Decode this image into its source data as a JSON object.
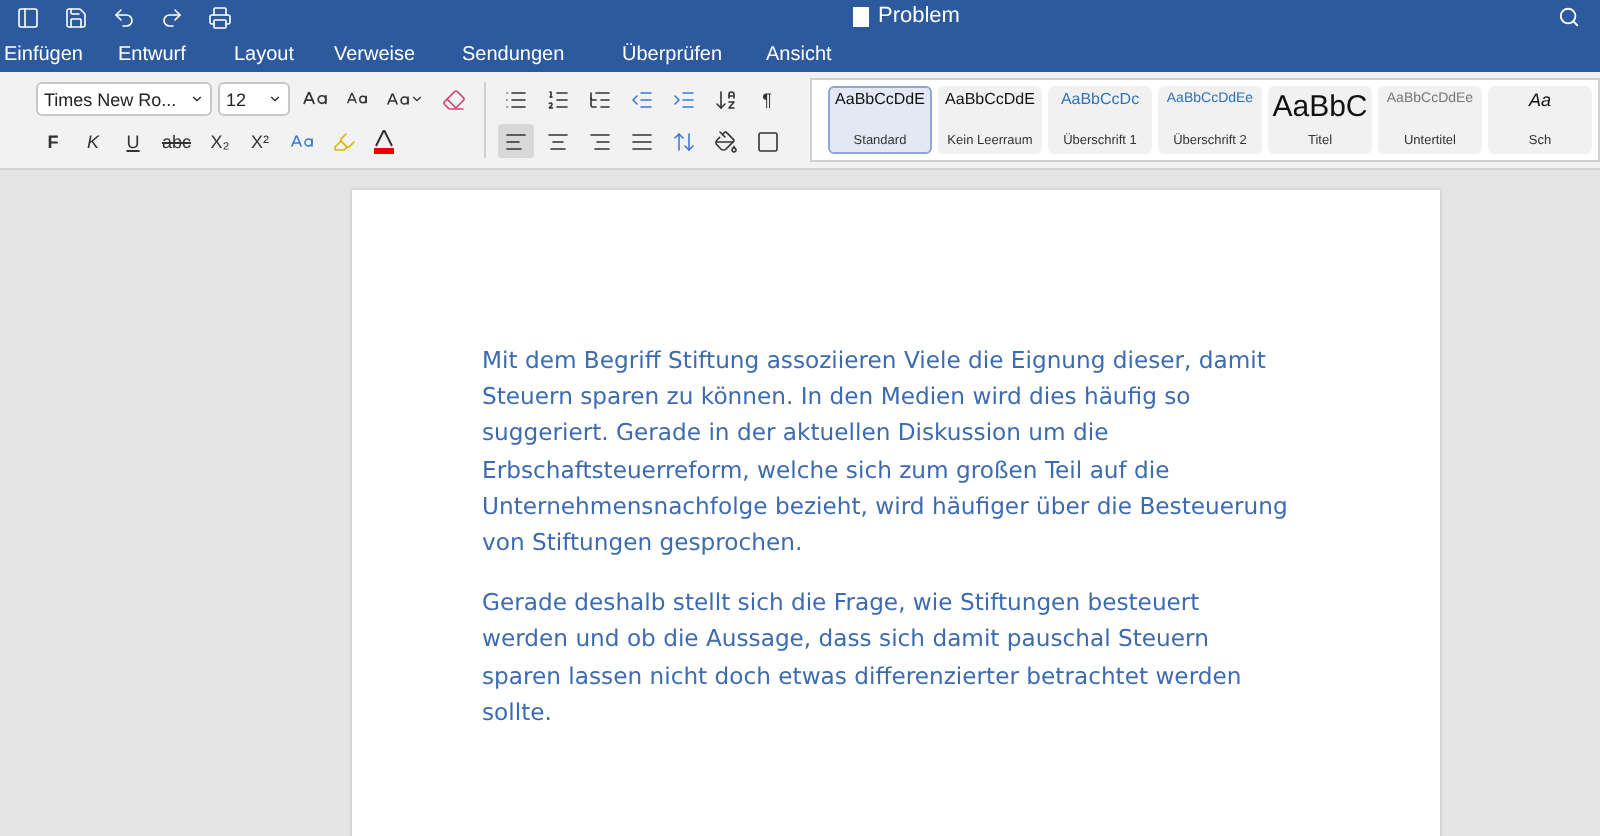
{
  "window": {
    "title": "Problem"
  },
  "menu_tabs": [
    {
      "label": "Einfügen",
      "selected": false
    },
    {
      "label": "Entwurf",
      "selected": false
    },
    {
      "label": "Layout",
      "selected": false
    },
    {
      "label": "Verweise",
      "selected": false
    },
    {
      "label": "Sendungen",
      "selected": false
    },
    {
      "label": "Überprüfen",
      "selected": false
    },
    {
      "label": "Ansicht",
      "selected": false
    }
  ],
  "font": {
    "name": "Times New Ro...",
    "size": "12"
  },
  "format_buttons": [
    {
      "label": "F",
      "kind": "bold"
    },
    {
      "label": "K",
      "kind": "italic"
    },
    {
      "label": "U",
      "kind": "underline"
    },
    {
      "label": "abc",
      "kind": "strike"
    },
    {
      "label": "X₂",
      "kind": "sub"
    },
    {
      "label": "X²",
      "kind": "sup"
    }
  ],
  "alignment": [
    {
      "kind": "left",
      "selected": true
    },
    {
      "kind": "center",
      "selected": false
    },
    {
      "kind": "right",
      "selected": false
    },
    {
      "kind": "justify",
      "selected": false
    }
  ],
  "pilcrow": "¶",
  "styles": [
    {
      "preview": "AaBbCcDdE",
      "label": "Standard",
      "kind": "normal",
      "selected": true
    },
    {
      "preview": "AaBbCcDdE",
      "label": "Kein Leerraum",
      "kind": "normal",
      "selected": false
    },
    {
      "preview": "AaBbCcDc",
      "label": "Überschrift 1",
      "kind": "heading1",
      "selected": false
    },
    {
      "preview": "AaBbCcDdEe",
      "label": "Überschrift 2",
      "kind": "heading2",
      "selected": false
    },
    {
      "preview": "AaBbC",
      "label": "Titel",
      "kind": "title",
      "selected": false
    },
    {
      "preview": "AaBbCcDdEe",
      "label": "Untertitel",
      "kind": "subtitle",
      "selected": false
    },
    {
      "preview": "Aa",
      "label": "Sch",
      "kind": "emphasis",
      "selected": false
    }
  ],
  "document": {
    "paragraphs": [
      "Mit dem Begriff Stiftung assoziieren Viele die Eignung dieser, damit Steuern sparen zu können. In den Medien wird dies häufig so suggeriert. Gerade in der aktuellen Diskussion um die Erbschaftsteuerreform, welche sich zum großen Teil auf die Unternehmensnachfolge bezieht, wird häufiger über die Besteuerung von Stiftungen gesprochen.",
      "Gerade deshalb stellt sich die Frage, wie Stiftungen besteuert werden und ob die Aussage, dass sich damit pauschal Steuern sparen lassen nicht doch etwas differenzierter betrachtet werden sollte."
    ]
  }
}
